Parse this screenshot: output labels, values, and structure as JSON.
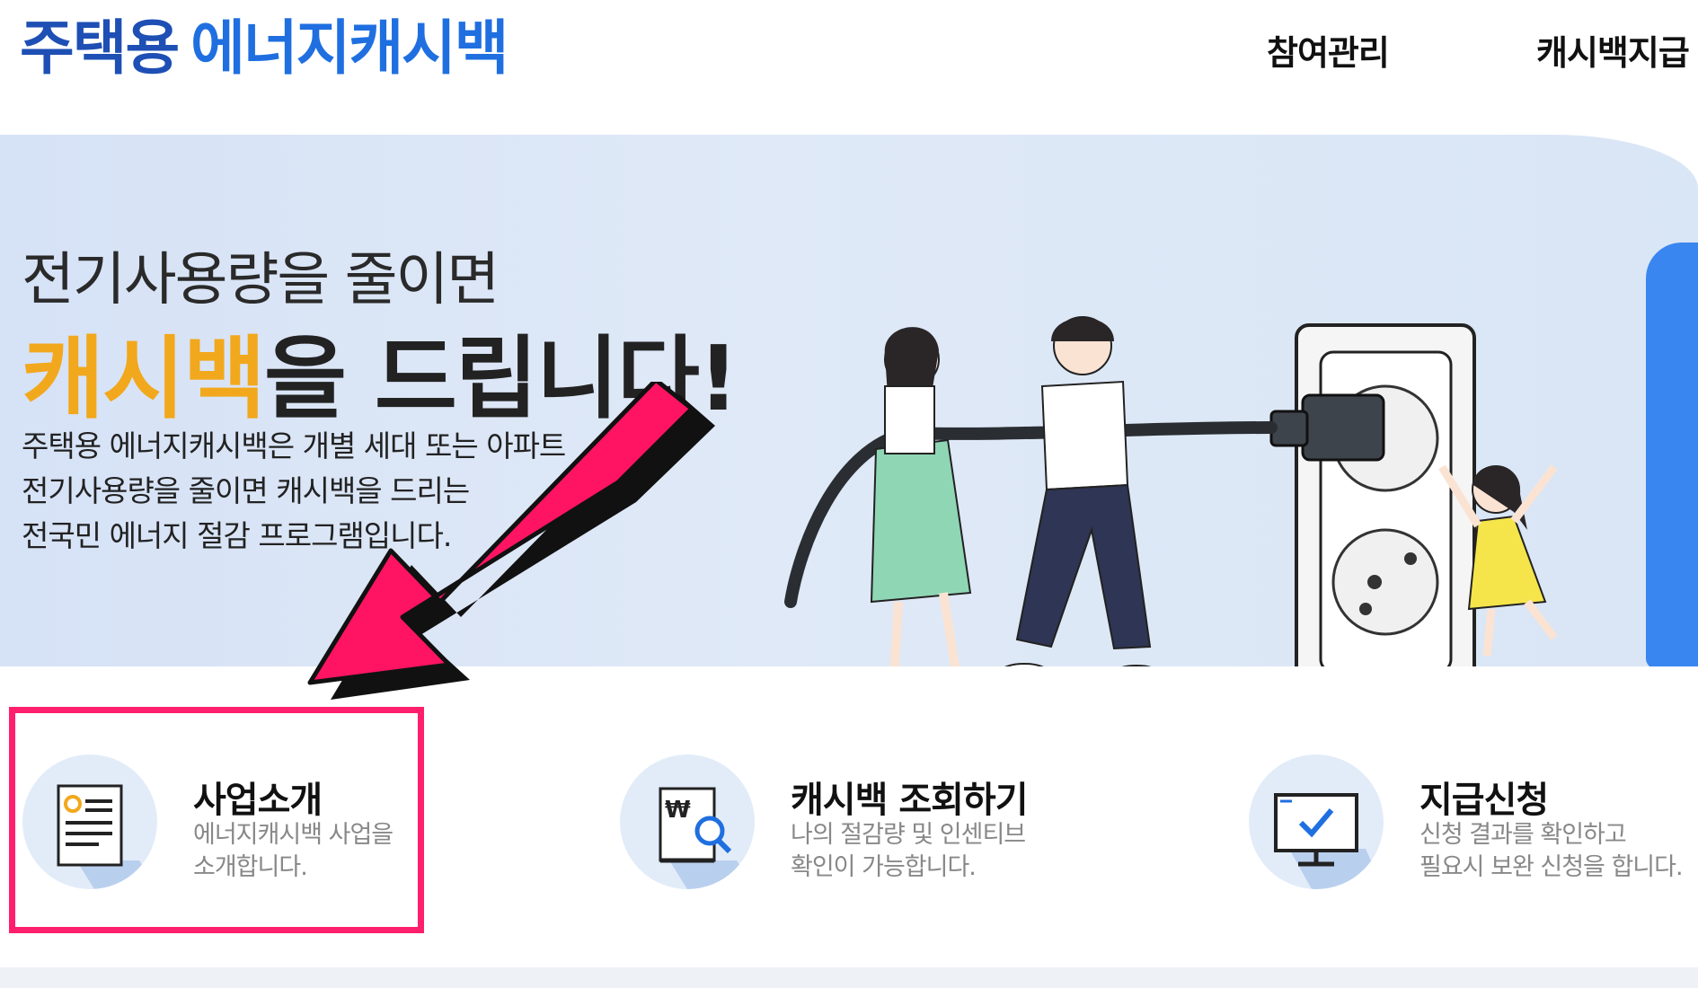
{
  "header": {
    "logo_part1": "주택용",
    "logo_part2": "에너지캐시백",
    "nav": [
      "참여관리",
      "캐시백지급"
    ]
  },
  "hero": {
    "line1": "전기사용량을 줄이면",
    "line2_highlight": "캐시백",
    "line2_rest": "을 드립니다!",
    "desc": [
      "주택용 에너지캐시백은 개별 세대 또는 아파트",
      "전기사용량을 줄이면 캐시백을 드리는",
      "전국민 에너지 절감 프로그램입니다."
    ]
  },
  "cards": [
    {
      "title": "사업소개",
      "desc1": "에너지캐시백 사업을",
      "desc2": "소개합니다.",
      "icon": "document-icon"
    },
    {
      "title": "캐시백 조회하기",
      "desc1": "나의 절감량 및 인센티브",
      "desc2": "확인이 가능합니다.",
      "icon": "won-search-icon"
    },
    {
      "title": "지급신청",
      "desc1": "신청 결과를 확인하고",
      "desc2": "필요시 보완 신청을 합니다.",
      "icon": "monitor-check-icon"
    }
  ],
  "colors": {
    "logo_dark": "#1e4fb4",
    "logo_blue": "#1f6fe0",
    "cashback_orange": "#f2a81c",
    "highlight_pink": "#ff1f6c"
  }
}
